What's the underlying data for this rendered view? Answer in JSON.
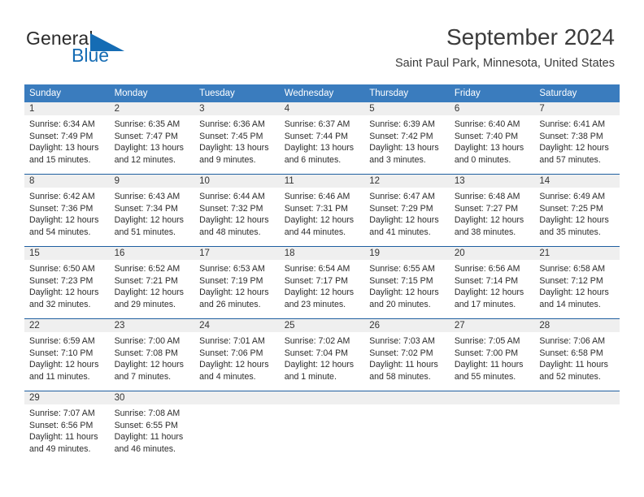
{
  "brand": {
    "name_top": "General",
    "name_bottom": "Blue",
    "triangle_icon": "blue-triangle-icon",
    "color_top": "#2b2b2b",
    "color_bottom": "#156cb4"
  },
  "header": {
    "title": "September 2024",
    "subtitle": "Saint Paul Park, Minnesota, United States"
  },
  "theme": {
    "header_blue": "#3a7cbe",
    "row_divider_blue": "#1f5fa0",
    "date_band_gray": "#efefef",
    "text": "#2c2c2c"
  },
  "calendar": {
    "weekdays": [
      "Sunday",
      "Monday",
      "Tuesday",
      "Wednesday",
      "Thursday",
      "Friday",
      "Saturday"
    ],
    "weeks": [
      [
        {
          "day": "1",
          "sunrise": "Sunrise: 6:34 AM",
          "sunset": "Sunset: 7:49 PM",
          "daylight_1": "Daylight: 13 hours",
          "daylight_2": "and 15 minutes."
        },
        {
          "day": "2",
          "sunrise": "Sunrise: 6:35 AM",
          "sunset": "Sunset: 7:47 PM",
          "daylight_1": "Daylight: 13 hours",
          "daylight_2": "and 12 minutes."
        },
        {
          "day": "3",
          "sunrise": "Sunrise: 6:36 AM",
          "sunset": "Sunset: 7:45 PM",
          "daylight_1": "Daylight: 13 hours",
          "daylight_2": "and 9 minutes."
        },
        {
          "day": "4",
          "sunrise": "Sunrise: 6:37 AM",
          "sunset": "Sunset: 7:44 PM",
          "daylight_1": "Daylight: 13 hours",
          "daylight_2": "and 6 minutes."
        },
        {
          "day": "5",
          "sunrise": "Sunrise: 6:39 AM",
          "sunset": "Sunset: 7:42 PM",
          "daylight_1": "Daylight: 13 hours",
          "daylight_2": "and 3 minutes."
        },
        {
          "day": "6",
          "sunrise": "Sunrise: 6:40 AM",
          "sunset": "Sunset: 7:40 PM",
          "daylight_1": "Daylight: 13 hours",
          "daylight_2": "and 0 minutes."
        },
        {
          "day": "7",
          "sunrise": "Sunrise: 6:41 AM",
          "sunset": "Sunset: 7:38 PM",
          "daylight_1": "Daylight: 12 hours",
          "daylight_2": "and 57 minutes."
        }
      ],
      [
        {
          "day": "8",
          "sunrise": "Sunrise: 6:42 AM",
          "sunset": "Sunset: 7:36 PM",
          "daylight_1": "Daylight: 12 hours",
          "daylight_2": "and 54 minutes."
        },
        {
          "day": "9",
          "sunrise": "Sunrise: 6:43 AM",
          "sunset": "Sunset: 7:34 PM",
          "daylight_1": "Daylight: 12 hours",
          "daylight_2": "and 51 minutes."
        },
        {
          "day": "10",
          "sunrise": "Sunrise: 6:44 AM",
          "sunset": "Sunset: 7:32 PM",
          "daylight_1": "Daylight: 12 hours",
          "daylight_2": "and 48 minutes."
        },
        {
          "day": "11",
          "sunrise": "Sunrise: 6:46 AM",
          "sunset": "Sunset: 7:31 PM",
          "daylight_1": "Daylight: 12 hours",
          "daylight_2": "and 44 minutes."
        },
        {
          "day": "12",
          "sunrise": "Sunrise: 6:47 AM",
          "sunset": "Sunset: 7:29 PM",
          "daylight_1": "Daylight: 12 hours",
          "daylight_2": "and 41 minutes."
        },
        {
          "day": "13",
          "sunrise": "Sunrise: 6:48 AM",
          "sunset": "Sunset: 7:27 PM",
          "daylight_1": "Daylight: 12 hours",
          "daylight_2": "and 38 minutes."
        },
        {
          "day": "14",
          "sunrise": "Sunrise: 6:49 AM",
          "sunset": "Sunset: 7:25 PM",
          "daylight_1": "Daylight: 12 hours",
          "daylight_2": "and 35 minutes."
        }
      ],
      [
        {
          "day": "15",
          "sunrise": "Sunrise: 6:50 AM",
          "sunset": "Sunset: 7:23 PM",
          "daylight_1": "Daylight: 12 hours",
          "daylight_2": "and 32 minutes."
        },
        {
          "day": "16",
          "sunrise": "Sunrise: 6:52 AM",
          "sunset": "Sunset: 7:21 PM",
          "daylight_1": "Daylight: 12 hours",
          "daylight_2": "and 29 minutes."
        },
        {
          "day": "17",
          "sunrise": "Sunrise: 6:53 AM",
          "sunset": "Sunset: 7:19 PM",
          "daylight_1": "Daylight: 12 hours",
          "daylight_2": "and 26 minutes."
        },
        {
          "day": "18",
          "sunrise": "Sunrise: 6:54 AM",
          "sunset": "Sunset: 7:17 PM",
          "daylight_1": "Daylight: 12 hours",
          "daylight_2": "and 23 minutes."
        },
        {
          "day": "19",
          "sunrise": "Sunrise: 6:55 AM",
          "sunset": "Sunset: 7:15 PM",
          "daylight_1": "Daylight: 12 hours",
          "daylight_2": "and 20 minutes."
        },
        {
          "day": "20",
          "sunrise": "Sunrise: 6:56 AM",
          "sunset": "Sunset: 7:14 PM",
          "daylight_1": "Daylight: 12 hours",
          "daylight_2": "and 17 minutes."
        },
        {
          "day": "21",
          "sunrise": "Sunrise: 6:58 AM",
          "sunset": "Sunset: 7:12 PM",
          "daylight_1": "Daylight: 12 hours",
          "daylight_2": "and 14 minutes."
        }
      ],
      [
        {
          "day": "22",
          "sunrise": "Sunrise: 6:59 AM",
          "sunset": "Sunset: 7:10 PM",
          "daylight_1": "Daylight: 12 hours",
          "daylight_2": "and 11 minutes."
        },
        {
          "day": "23",
          "sunrise": "Sunrise: 7:00 AM",
          "sunset": "Sunset: 7:08 PM",
          "daylight_1": "Daylight: 12 hours",
          "daylight_2": "and 7 minutes."
        },
        {
          "day": "24",
          "sunrise": "Sunrise: 7:01 AM",
          "sunset": "Sunset: 7:06 PM",
          "daylight_1": "Daylight: 12 hours",
          "daylight_2": "and 4 minutes."
        },
        {
          "day": "25",
          "sunrise": "Sunrise: 7:02 AM",
          "sunset": "Sunset: 7:04 PM",
          "daylight_1": "Daylight: 12 hours",
          "daylight_2": "and 1 minute."
        },
        {
          "day": "26",
          "sunrise": "Sunrise: 7:03 AM",
          "sunset": "Sunset: 7:02 PM",
          "daylight_1": "Daylight: 11 hours",
          "daylight_2": "and 58 minutes."
        },
        {
          "day": "27",
          "sunrise": "Sunrise: 7:05 AM",
          "sunset": "Sunset: 7:00 PM",
          "daylight_1": "Daylight: 11 hours",
          "daylight_2": "and 55 minutes."
        },
        {
          "day": "28",
          "sunrise": "Sunrise: 7:06 AM",
          "sunset": "Sunset: 6:58 PM",
          "daylight_1": "Daylight: 11 hours",
          "daylight_2": "and 52 minutes."
        }
      ],
      [
        {
          "day": "29",
          "sunrise": "Sunrise: 7:07 AM",
          "sunset": "Sunset: 6:56 PM",
          "daylight_1": "Daylight: 11 hours",
          "daylight_2": "and 49 minutes."
        },
        {
          "day": "30",
          "sunrise": "Sunrise: 7:08 AM",
          "sunset": "Sunset: 6:55 PM",
          "daylight_1": "Daylight: 11 hours",
          "daylight_2": "and 46 minutes."
        },
        {
          "day": "",
          "sunrise": "",
          "sunset": "",
          "daylight_1": "",
          "daylight_2": ""
        },
        {
          "day": "",
          "sunrise": "",
          "sunset": "",
          "daylight_1": "",
          "daylight_2": ""
        },
        {
          "day": "",
          "sunrise": "",
          "sunset": "",
          "daylight_1": "",
          "daylight_2": ""
        },
        {
          "day": "",
          "sunrise": "",
          "sunset": "",
          "daylight_1": "",
          "daylight_2": ""
        },
        {
          "day": "",
          "sunrise": "",
          "sunset": "",
          "daylight_1": "",
          "daylight_2": ""
        }
      ]
    ]
  }
}
